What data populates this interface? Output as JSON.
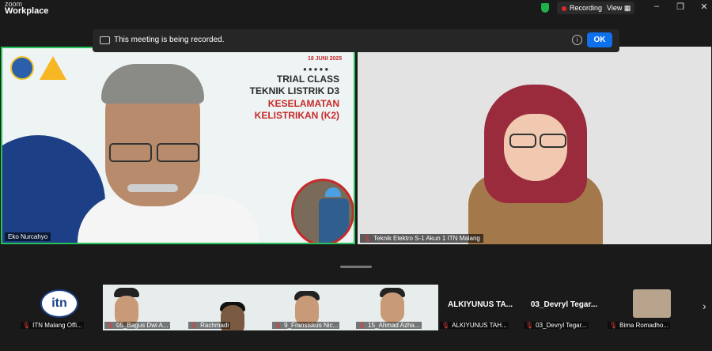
{
  "app": {
    "brand_small": "zoom",
    "brand_large": "Workplace"
  },
  "titlebar": {
    "recording_label": "Recording",
    "view_label": "View"
  },
  "banner": {
    "message": "This meeting is being recorded.",
    "ok_label": "OK"
  },
  "speaker": {
    "name": "Eko Nurcahyo",
    "slide": {
      "date": "18 JUNI 2025",
      "line1": "TRIAL CLASS",
      "line2": "TEKNIK LISTRIK D3",
      "line3": "KESELAMATAN",
      "line4": "KELISTRIKAN (K2)"
    }
  },
  "second_tile": {
    "name": "Teknik Elektro S-1 Akun 1 ITN Malang"
  },
  "thumbnails": [
    {
      "name": "ITN Malang Offi..."
    },
    {
      "name": "05_Bagus Dwi A..."
    },
    {
      "name": "Rachmadi"
    },
    {
      "name": "9_Fransiskus Nic..."
    },
    {
      "name": "15_Ahmad Azha..."
    },
    {
      "name": "ALKIYUNUS TAH...",
      "big": "ALKIYUNUS TA..."
    },
    {
      "name": "03_Devryl Tegar...",
      "big": "03_Devryl Tegar..."
    },
    {
      "name": "Bima Romadho..."
    }
  ],
  "colors": {
    "accent": "#0e71eb",
    "active_speaker": "#26c15a",
    "muted": "#e03a3a"
  }
}
